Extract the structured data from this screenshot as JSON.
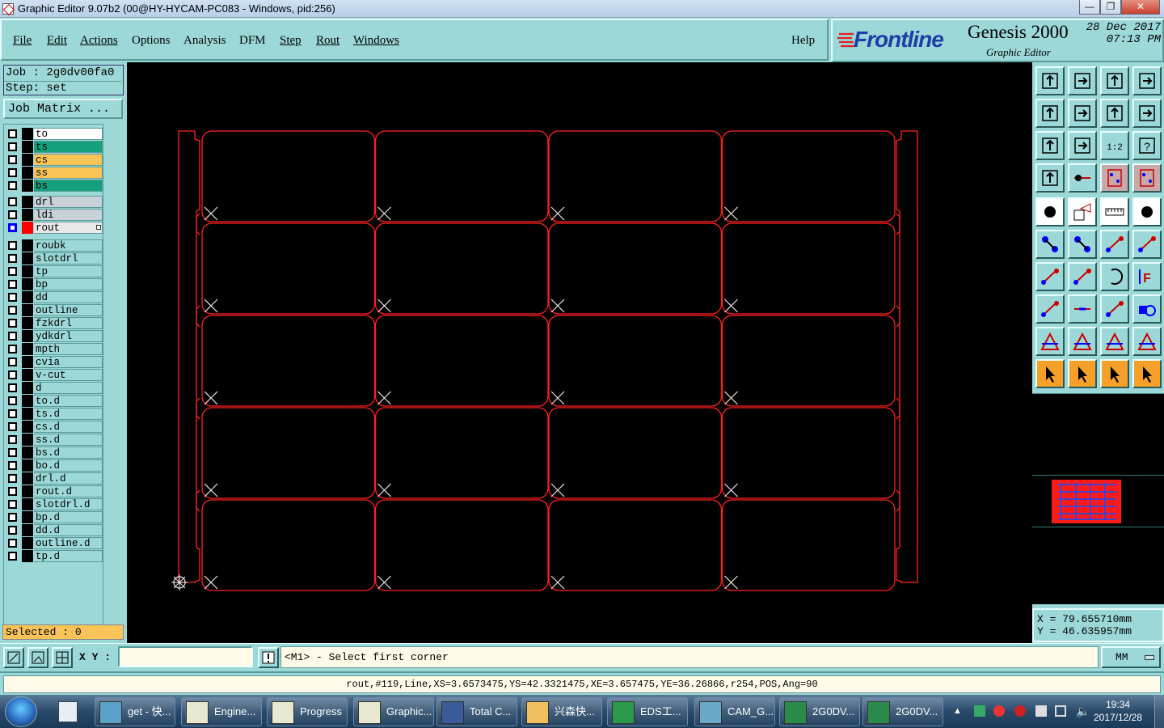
{
  "window": {
    "title": "Graphic Editor 9.07b2 (00@HY-HYCAM-PC083 - Windows, pid:256)",
    "controls": [
      "—",
      "❐",
      "✕"
    ]
  },
  "menubar": {
    "items": [
      {
        "label": "File"
      },
      {
        "label": "Edit"
      },
      {
        "label": "Actions"
      },
      {
        "label": "Options"
      },
      {
        "label": "Analysis"
      },
      {
        "label": "DFM"
      },
      {
        "label": "Step"
      },
      {
        "label": "Rout"
      },
      {
        "label": "Windows"
      }
    ],
    "help": "Help"
  },
  "brand": {
    "logo": "Frontline",
    "product": "Genesis 2000",
    "subtitle": "Graphic Editor",
    "date": "28 Dec 2017",
    "time": "07:13 PM"
  },
  "job": {
    "job_line": "Job : 2g0dv00fa0",
    "step_line": "Step: set",
    "job_matrix_label": "Job Matrix ..."
  },
  "layers": {
    "group1": [
      {
        "name": "to",
        "bg": "#ffffff"
      },
      {
        "name": "ts",
        "bg": "#14a07a"
      },
      {
        "name": "cs",
        "bg": "#fbc458"
      },
      {
        "name": "ss",
        "bg": "#fbc458"
      },
      {
        "name": "bs",
        "bg": "#14a07a"
      }
    ],
    "group2": [
      {
        "name": "drl",
        "bg": "#c8d0d8"
      },
      {
        "name": "ldi",
        "bg": "#c8d0d8"
      },
      {
        "name": "rout",
        "bg": "#e8e8e8",
        "active": true
      }
    ],
    "group3": [
      {
        "name": "roubk"
      },
      {
        "name": "slotdrl"
      },
      {
        "name": "tp"
      },
      {
        "name": "bp"
      },
      {
        "name": "dd"
      },
      {
        "name": "outline"
      },
      {
        "name": "fzkdrl"
      },
      {
        "name": "ydkdrl"
      },
      {
        "name": "mpth"
      },
      {
        "name": "cvia"
      },
      {
        "name": "v-cut"
      },
      {
        "name": "d"
      },
      {
        "name": "to.d"
      },
      {
        "name": "ts.d"
      },
      {
        "name": "cs.d"
      },
      {
        "name": "ss.d"
      },
      {
        "name": "bs.d"
      },
      {
        "name": "bo.d"
      },
      {
        "name": "drl.d"
      },
      {
        "name": "rout.d"
      },
      {
        "name": "slotdrl.d"
      },
      {
        "name": "bp.d"
      },
      {
        "name": "dd.d"
      },
      {
        "name": "outline.d"
      },
      {
        "name": "tp.d"
      }
    ]
  },
  "selected": "Selected : 0",
  "coords": {
    "x": "X = 79.655710mm",
    "y": "Y = 46.635957mm"
  },
  "command": {
    "xy_label": "X Y :",
    "xy_value": "",
    "prompt": "<M1> - Select first corner",
    "units": "MM"
  },
  "status_text": "rout,#119,Line,XS=3.6573475,YS=42.3321475,XE=3.657475,YE=36.26866,r254,POS,Ang=90",
  "canvas": {
    "color": "#ff2020",
    "cols": 4,
    "rows": 5
  },
  "taskbar": {
    "items": [
      {
        "label": "get - 快..."
      },
      {
        "label": "Engine..."
      },
      {
        "label": "Progress"
      },
      {
        "label": "Graphic..."
      },
      {
        "label": "Total C..."
      },
      {
        "label": "兴森快..."
      },
      {
        "label": "EDS工..."
      },
      {
        "label": "CAM_G..."
      },
      {
        "label": "2G0DV..."
      },
      {
        "label": "2G0DV..."
      }
    ],
    "clock_time": "19:34",
    "clock_date": "2017/12/28"
  }
}
